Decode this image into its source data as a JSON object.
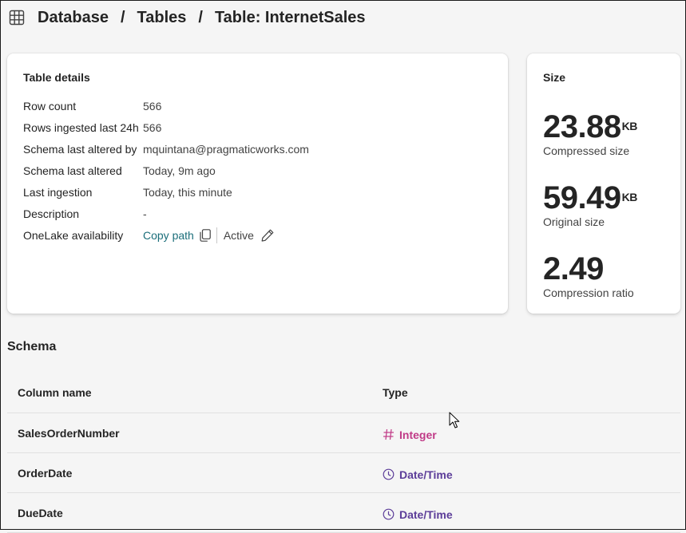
{
  "breadcrumb": {
    "icon": "table-grid-icon",
    "items": [
      "Database",
      "Tables",
      "Table: InternetSales"
    ],
    "separator": "/"
  },
  "details": {
    "title": "Table details",
    "rows": [
      {
        "label": "Row count",
        "value": "566"
      },
      {
        "label": "Rows ingested last 24h",
        "value": "566"
      },
      {
        "label": "Schema last altered by",
        "value": "mquintana@pragmaticworks.com"
      },
      {
        "label": "Schema last altered",
        "value": "Today, 9m ago"
      },
      {
        "label": "Last ingestion",
        "value": "Today, this minute"
      },
      {
        "label": "Description",
        "value": "-"
      }
    ],
    "onelake": {
      "label": "OneLake availability",
      "copy_label": "Copy path",
      "status": "Active"
    }
  },
  "size": {
    "title": "Size",
    "compressed": {
      "value": "23.88",
      "unit": "KB",
      "label": "Compressed size"
    },
    "original": {
      "value": "59.49",
      "unit": "KB",
      "label": "Original size"
    },
    "ratio": {
      "value": "2.49",
      "label": "Compression ratio"
    }
  },
  "schema": {
    "title": "Schema",
    "headers": {
      "name": "Column name",
      "type": "Type"
    },
    "rows": [
      {
        "name": "SalesOrderNumber",
        "type": "Integer",
        "icon": "hash-icon",
        "color": "#c03a87"
      },
      {
        "name": "OrderDate",
        "type": "Date/Time",
        "icon": "clock-icon",
        "color": "#5c3d99"
      },
      {
        "name": "DueDate",
        "type": "Date/Time",
        "icon": "clock-icon",
        "color": "#5c3d99"
      }
    ]
  },
  "colors": {
    "link": "#1b6e7a",
    "integer": "#c03a87",
    "datetime": "#5c3d99"
  }
}
